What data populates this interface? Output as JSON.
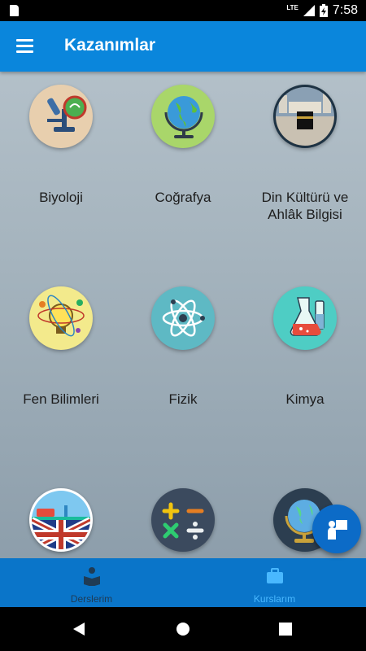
{
  "status_bar": {
    "network": "LTE",
    "time": "7:58"
  },
  "app_bar": {
    "title": "Kazanımlar"
  },
  "subjects": [
    {
      "label": "Biyoloji",
      "icon": "microscope-icon"
    },
    {
      "label": "Coğrafya",
      "icon": "globe-icon"
    },
    {
      "label": "Din Kültürü ve Ahlâk Bilgisi",
      "icon": "kaaba-icon"
    },
    {
      "label": "Fen Bilimleri",
      "icon": "lightbulb-science-icon"
    },
    {
      "label": "Fizik",
      "icon": "atom-icon"
    },
    {
      "label": "Kimya",
      "icon": "flask-icon"
    },
    {
      "label": "",
      "icon": "london-flag-icon"
    },
    {
      "label": "",
      "icon": "math-operations-icon"
    },
    {
      "label": "",
      "icon": "desk-globe-icon"
    }
  ],
  "bottom_nav": [
    {
      "label": "Derslerim",
      "icon": "reading-book-icon",
      "active": false
    },
    {
      "label": "Kurslarım",
      "icon": "briefcase-icon",
      "active": true
    }
  ],
  "fab": {
    "icon": "teacher-board-icon"
  },
  "colors": {
    "primary": "#0a86dc",
    "bottom_nav": "#0a75c9",
    "active": "#49b8ff"
  }
}
